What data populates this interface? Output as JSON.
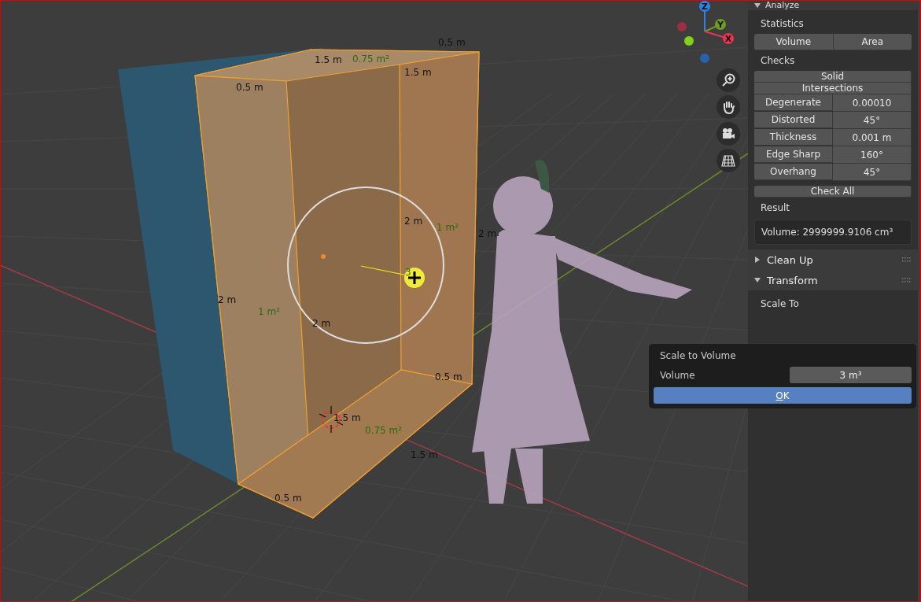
{
  "viewport": {
    "measurements": [
      {
        "text": "1.5 m",
        "kind": "length"
      },
      {
        "text": "0.75 m²",
        "kind": "area"
      },
      {
        "text": "1.5 m",
        "kind": "length"
      },
      {
        "text": "0.5 m",
        "kind": "length"
      },
      {
        "text": "0.5 m",
        "kind": "length"
      },
      {
        "text": "2 m",
        "kind": "length"
      },
      {
        "text": "1 m²",
        "kind": "area"
      },
      {
        "text": "2 m",
        "kind": "length"
      },
      {
        "text": "3",
        "kind": "area"
      },
      {
        "text": "2 m",
        "kind": "length"
      },
      {
        "text": "1 m²",
        "kind": "area"
      },
      {
        "text": "2 m",
        "kind": "length"
      },
      {
        "text": "0.5 m",
        "kind": "length"
      },
      {
        "text": "1.5 m",
        "kind": "length"
      },
      {
        "text": "0.75 m²",
        "kind": "area"
      },
      {
        "text": "1.5 m",
        "kind": "length"
      },
      {
        "text": "0.5 m",
        "kind": "length"
      }
    ],
    "gizmo": {
      "axes": [
        {
          "label": "Z",
          "color": "#2f83e6"
        },
        {
          "label": "Y",
          "color": "#6f9c1f"
        },
        {
          "label": "X",
          "color": "#e8344f"
        }
      ]
    }
  },
  "panel": {
    "header": {
      "title": "Analyze",
      "expanded": true
    },
    "statistics_label": "Statistics",
    "statistics_buttons": [
      "Volume",
      "Area"
    ],
    "checks_label": "Checks",
    "check_buttons": [
      "Solid",
      "Intersections"
    ],
    "check_rows": [
      {
        "label": "Degenerate",
        "value": "0.00010"
      },
      {
        "label": "Distorted",
        "value": "45°"
      },
      {
        "label": "Thickness",
        "value": "0.001 m"
      },
      {
        "label": "Edge Sharp",
        "value": "160°"
      },
      {
        "label": "Overhang",
        "value": "45°"
      }
    ],
    "check_all": "Check All",
    "result_label": "Result",
    "result": "Volume: 2999999.9106 cm³",
    "sections": [
      {
        "title": "Clean Up",
        "expanded": false
      },
      {
        "title": "Transform",
        "expanded": true
      }
    ],
    "scale_to_label": "Scale To"
  },
  "popup": {
    "title": "Scale to Volume",
    "field_label": "Volume",
    "value": "3 m³",
    "button": "OK"
  }
}
